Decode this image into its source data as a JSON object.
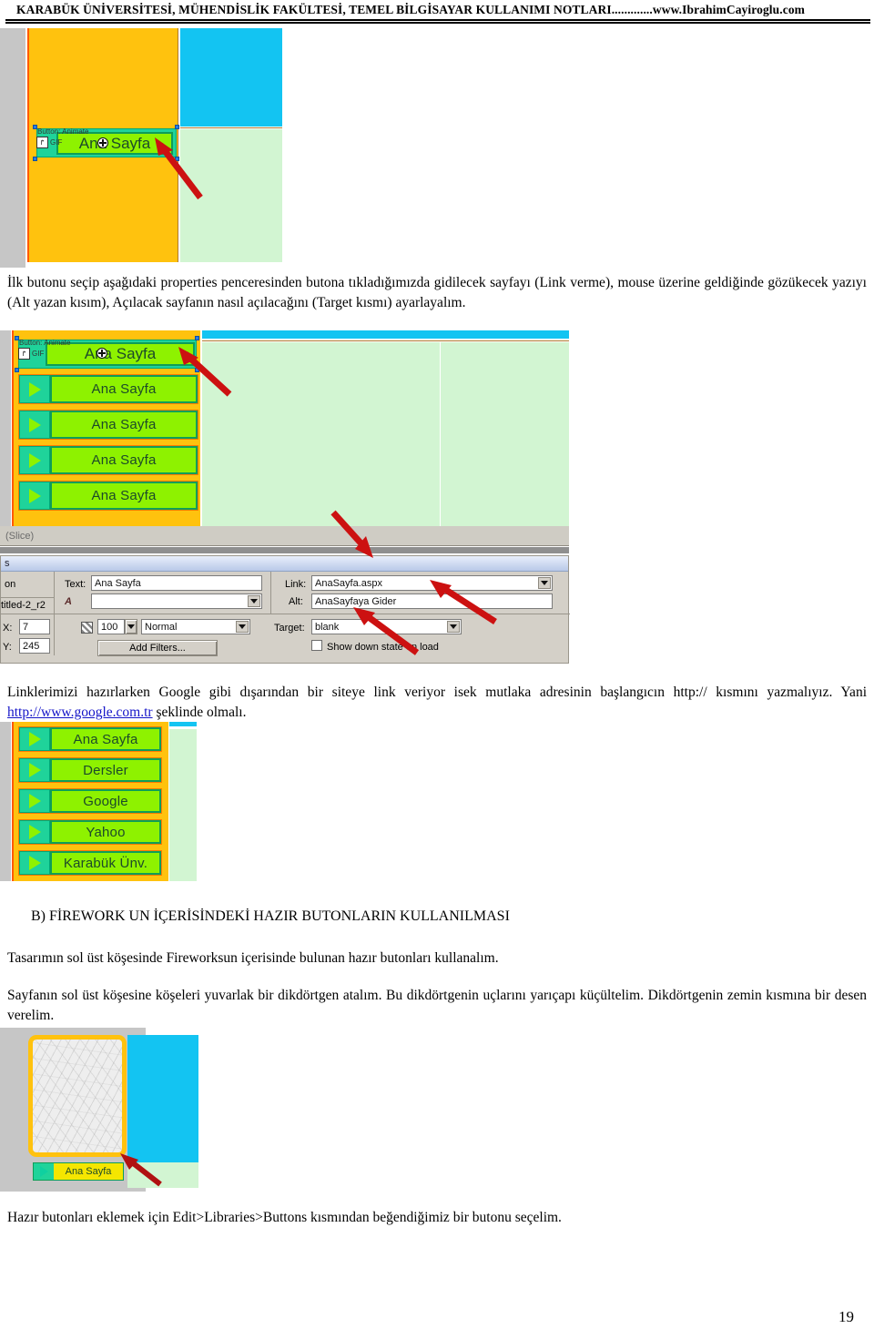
{
  "header": {
    "text": "KARABÜK ÜNİVERSİTESİ, MÜHENDİSLİK FAKÜLTESİ, TEMEL BİLGİSAYAR KULLANIMI NOTLARI.............www.IbrahimCayiroglu.com"
  },
  "page_number": "19",
  "paragraphs": {
    "p1": "İlk butonu seçip aşağıdaki properties penceresinden butona tıkladığımızda gidilecek sayfayı (Link verme), mouse üzerine geldiğinde gözükecek yazıyı (Alt yazan kısım), Açılacak sayfanın nasıl açılacağını (Target kısmı) ayarlayalım.",
    "p2_before": "Linklerimizi hazırlarken Google gibi dışarından bir siteye link veriyor isek mutlaka adresinin başlangıcın http:// kısmını yazmalıyız. Yani ",
    "p2_link": "http://www.google.com.tr",
    "p2_after": " şeklinde olmalı.",
    "heading_b": "B)   FİREWORK UN İÇERİSİNDEKİ HAZIR BUTONLARIN KULLANILMASI",
    "p3": "Tasarımın sol üst köşesinde Fireworksun içerisinde bulunan hazır butonları kullanalım.",
    "p4": "Sayfanın sol üst köşesine köşeleri yuvarlak bir dikdörtgen atalım. Bu dikdörtgenin uçlarını yarıçapı küçültelim. Dikdörtgenin zemin kısmına bir desen verelim.",
    "p5": "Hazır butonları eklemek için Edit>Libraries>Buttons  kısmından beğendiğimiz bir butonu seçelim."
  },
  "shot1": {
    "selected_button": {
      "badge_type": "Button: Animate",
      "badge_format": "GIF",
      "label": "Ana Sayfa"
    }
  },
  "shot2": {
    "selected_button": {
      "badge_type": "Button: Animate",
      "badge_format": "GIF",
      "label": "Ana Sayfa"
    },
    "buttons": [
      {
        "label": "Ana Sayfa"
      },
      {
        "label": "Ana Sayfa"
      },
      {
        "label": "Ana Sayfa"
      },
      {
        "label": "Ana Sayfa"
      }
    ],
    "status_label": "(Slice)"
  },
  "properties_panel": {
    "title": "s",
    "object_type": "on",
    "object_name": "titled-2_r2",
    "x_label": "X:",
    "x_value": "7",
    "y_label": "Y:",
    "y_value": "245",
    "text_label": "Text:",
    "text_value": "Ana Sayfa",
    "font_label": "A",
    "font_value": "",
    "link_label": "Link:",
    "link_value": "AnaSayfa.aspx",
    "alt_label": "Alt:",
    "alt_value": "AnaSayfaya Gider",
    "opacity_value": "100",
    "blend_mode": "Normal",
    "target_label": "Target:",
    "target_value": "blank",
    "add_filters_label": "Add Filters...",
    "show_down_state_label": "Show down state on load"
  },
  "shot3": {
    "buttons": [
      {
        "label": "Ana Sayfa"
      },
      {
        "label": "Dersler"
      },
      {
        "label": "Google"
      },
      {
        "label": "Yahoo"
      },
      {
        "label": "Karabük Ünv."
      }
    ]
  },
  "shot4": {
    "button_label": "Ana Sayfa"
  },
  "colors": {
    "canvas_gray": "#c6c6c6",
    "region_orange": "#ffc20e",
    "region_cyan": "#13c4f2",
    "region_light_green": "#d2f5d2",
    "button_green": "#8ef200",
    "button_icon_teal": "#1fd39a",
    "button_border_orange": "#ff8c1a",
    "arrow_red": "#cc1111",
    "link_blue": "#1414c8",
    "panel_gray": "#d4d0c8",
    "selection_blue": "#0a246a",
    "yellow_button": "#f5e600"
  }
}
